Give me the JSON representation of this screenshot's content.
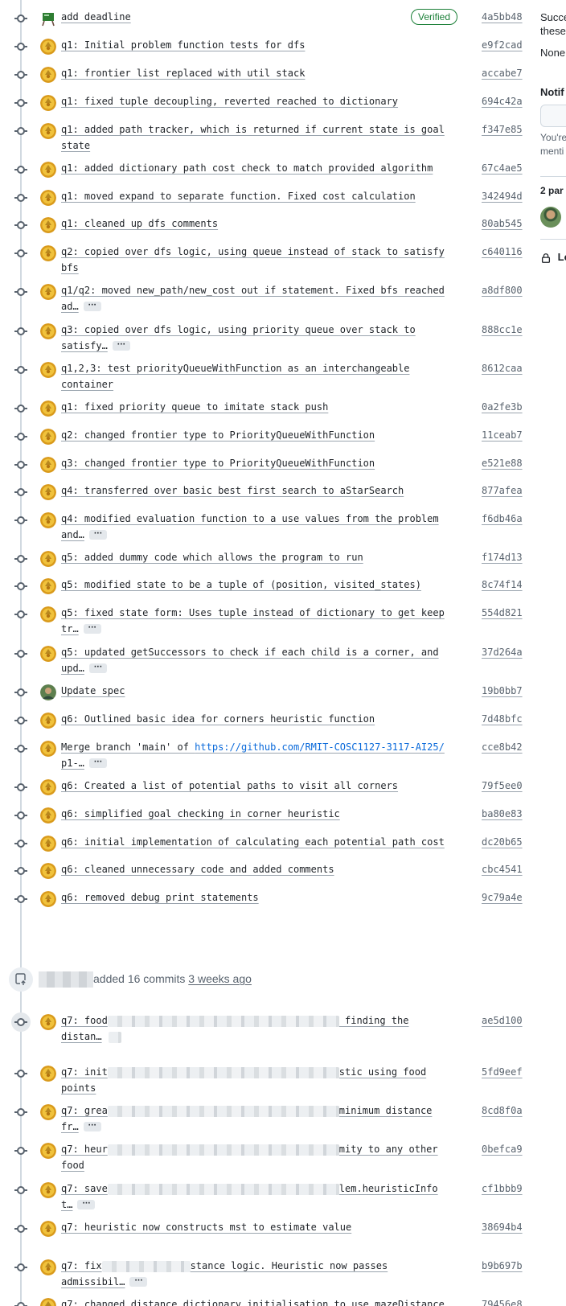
{
  "commits_a": [
    {
      "message": "add deadline",
      "sha": "4a5bb48",
      "verified": "Verified",
      "avatar": "sign-avatar"
    },
    {
      "message": "q1: Initial problem function tests for dfs",
      "sha": "e9f2cad"
    },
    {
      "message": "q1: frontier list replaced with util stack",
      "sha": "accabe7"
    },
    {
      "message": "q1: fixed tuple decoupling, reverted reached to dictionary",
      "sha": "694c42a"
    },
    {
      "message": "q1: added path tracker, which is returned if current state is goal",
      "message2": "state",
      "sha": "f347e85"
    },
    {
      "message": "q1: added dictionary path cost check to match provided algorithm",
      "sha": "67c4ae5"
    },
    {
      "message": "q1: moved expand to separate function. Fixed cost calculation",
      "sha": "342494d"
    },
    {
      "message": "q1: cleaned up dfs comments",
      "sha": "80ab545"
    },
    {
      "message": "q2: copied over dfs logic, using queue instead of stack to satisfy",
      "message2": "bfs",
      "sha": "c640116"
    },
    {
      "message": "q1/q2: moved new_path/new_cost out if statement. Fixed bfs reached",
      "message2": "ad…",
      "ellipsis": true,
      "sha": "a8df800"
    },
    {
      "message": "q3: copied over dfs logic, using priority queue over stack to",
      "message2": "satisfy…",
      "ellipsis": true,
      "sha": "888cc1e"
    },
    {
      "message": "q1,2,3: test priorityQueueWithFunction as an interchangeable",
      "message2": "container",
      "sha": "8612caa"
    },
    {
      "message": "q1: fixed priority queue to imitate stack push",
      "sha": "0a2fe3b"
    },
    {
      "message": "q2: changed frontier type to PriorityQueueWithFunction",
      "sha": "11ceab7"
    },
    {
      "message": "q3: changed frontier type to PriorityQueueWithFunction",
      "sha": "e521e88"
    },
    {
      "message": "q4: transferred over basic best first search to aStarSearch",
      "sha": "877afea"
    },
    {
      "message": "q4: modified evaluation function to a use values from the problem",
      "message2": "and…",
      "ellipsis": true,
      "sha": "f6db46a"
    },
    {
      "message": "q5: added dummy code which allows the program to run",
      "sha": "f174d13"
    },
    {
      "message": "q5: modified state to be a tuple of (position, visited_states)",
      "sha": "8c74f14"
    },
    {
      "message": "q5: fixed state form: Uses tuple instead of dictionary to get keep",
      "message2": "tr…",
      "ellipsis": true,
      "sha": "554d821"
    },
    {
      "message": "q5: updated getSuccessors to check if each child is a corner, and",
      "message2": "upd…",
      "ellipsis": true,
      "sha": "37d264a"
    },
    {
      "message": "Update spec",
      "sha": "19b0bb7",
      "avatar": "photo-avatar",
      "plain": true
    },
    {
      "message": "q6: Outlined basic idea for corners heuristic function",
      "sha": "7d48bfc"
    },
    {
      "message": "Merge branch 'main' of ",
      "link": "https://github.com/RMIT-COSC1127-3117-AI25/",
      "message2": "p1-…",
      "ellipsis": true,
      "sha": "cce8b42"
    },
    {
      "message": "q6: Created a list of potential paths to visit all corners",
      "sha": "79f5ee0"
    },
    {
      "message": "q6: simplified goal checking in corner heuristic",
      "sha": "ba80e83"
    },
    {
      "message": "q6: initial implementation of calculating each potential path cost",
      "sha": "dc20b65"
    },
    {
      "message": "q6: cleaned unnecessary code and added comments",
      "sha": "cbc4541"
    },
    {
      "message": "q6: removed debug print statements",
      "sha": "9c79a4e"
    }
  ],
  "event": {
    "action": "added 16 commits",
    "when": "3 weeks ago"
  },
  "commits_b": [
    {
      "pre": "q7: food",
      "post": " finding the",
      "message2": "distan…",
      "sha": "ae5d100"
    },
    {
      "pre": "q7: init",
      "post": "stic using food",
      "message2": "points",
      "sha": "5fd9eef"
    },
    {
      "pre": "q7: grea",
      "post": "minimum distance",
      "message2": "fr…",
      "ellipsis": true,
      "sha": "8cd8f0a"
    },
    {
      "pre": "q7: heur",
      "post": "mity to any other",
      "message2": "food",
      "sha": "0befca9"
    },
    {
      "pre": "q7: save",
      "post": "lem.heuristicInfo",
      "message2": "t…",
      "ellipsis": true,
      "sha": "cf1bbb9"
    },
    {
      "pre": "q7: heuristic now constructs mst to estimate value",
      "post": "",
      "sha": "38694b4"
    },
    {
      "pre": "q7: fix",
      "post": "stance logic. Heuristic now passes",
      "message2": "admissibil…",
      "ellipsis": true,
      "sha": "b9b697b"
    },
    {
      "pre": "q7: changed distance dictionary initialisation to use mazeDistance",
      "post": "",
      "sha": "79456e8"
    }
  ],
  "sidebar": {
    "text1": "Succe",
    "text2": "these",
    "none_label": "None",
    "notif_label": "Notif",
    "notif_text1": "You're",
    "notif_text2": "menti",
    "participants": "2 par",
    "lock_text": "Lo"
  }
}
